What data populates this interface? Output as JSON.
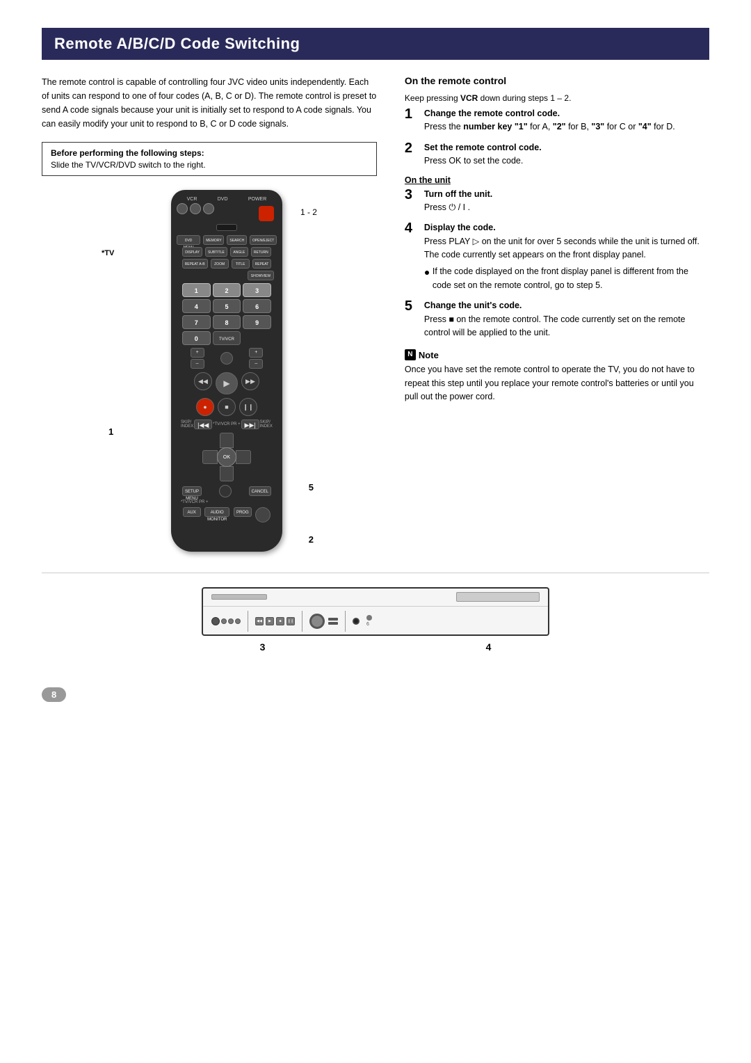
{
  "page": {
    "title": "Remote A/B/C/D Code Switching",
    "page_number": "8"
  },
  "intro": {
    "text": "The remote control is capable of controlling four JVC video units independently. Each of units can respond to one of four codes (A, B, C or D). The remote control is preset to send A code signals because your unit is initially set to respond to A code signals. You can easily modify your unit to respond to B, C or D code signals."
  },
  "prereq": {
    "title": "Before performing the following steps:",
    "text": "Slide the TV/VCR/DVD switch to the right."
  },
  "remote_section": {
    "on_remote_control_title": "On the remote control",
    "keep_pressing": "Keep pressing VCR down during steps 1 – 2.",
    "step1_title": "Change the remote control code.",
    "step1_text": "Press the number key \"1\" for A, \"2\" for B, \"3\" for C or \"4\" for D.",
    "step2_title": "Set the remote control code.",
    "step2_text": "Press OK to set the code.",
    "on_unit_label": "On the unit",
    "step3_title": "Turn off the unit.",
    "step3_text": "Press ⏻ / I .",
    "step4_title": "Display the code.",
    "step4_text": "Press PLAY ▷  on the unit for over 5 seconds while the unit is turned off. The code currently set appears on the front display panel.",
    "step4_bullet": "If the code displayed on the front display panel is different from the code set on the remote control, go to step 5.",
    "step5_title": "Change the unit's code.",
    "step5_text": "Press ■ on the remote control. The code currently set on the remote control will be applied to the unit.",
    "note_title": "Note",
    "note_text": "Once you have set the remote control to operate the TV, you do not have to repeat this step until you replace your remote control's batteries or until you pull out the power cord."
  },
  "diagram_labels": {
    "label_1": "1",
    "label_2": "2",
    "label_3": "3",
    "label_4": "4",
    "label_5": "5",
    "label_1_2": "1 - 2",
    "tv_label": "*TV"
  },
  "remote": {
    "vcr_label": "VCR",
    "dvd_label": "DVD",
    "power_label": "POWER",
    "num_keys": [
      "1",
      "2",
      "3",
      "4",
      "5",
      "6",
      "7",
      "8",
      "9",
      "0"
    ],
    "ok_label": "OK",
    "transport_labels": [
      "◀◀",
      "●",
      "▶",
      "■",
      "▶▶",
      "❙❙"
    ]
  },
  "unit_labels": {
    "label3": "3",
    "label4": "4"
  }
}
